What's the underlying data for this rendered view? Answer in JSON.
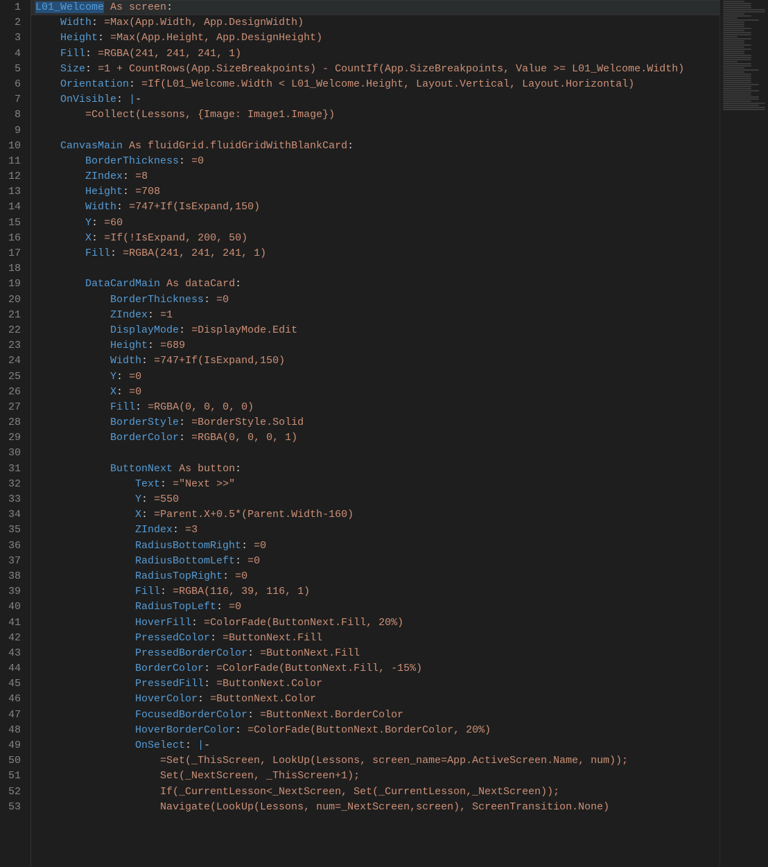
{
  "editor": {
    "active_line": 1,
    "lines": [
      {
        "n": 1,
        "html": "<span class='s-key sel'>L01_Welcome</span> <span class='s-type'>As screen</span><span class='s-punc'>:</span>"
      },
      {
        "n": 2,
        "html": "    <span class='s-key'>Width</span><span class='s-punc'>:</span> <span class='s-call'>=Max(App.Width, App.DesignWidth)</span>"
      },
      {
        "n": 3,
        "html": "    <span class='s-key'>Height</span><span class='s-punc'>:</span> <span class='s-call'>=Max(App.Height, App.DesignHeight)</span>"
      },
      {
        "n": 4,
        "html": "    <span class='s-key'>Fill</span><span class='s-punc'>:</span> <span class='s-call'>=RGBA(241, 241, 241, 1)</span>"
      },
      {
        "n": 5,
        "html": "    <span class='s-key'>Size</span><span class='s-punc'>:</span> <span class='s-call'>=1 + CountRows(App.SizeBreakpoints) - CountIf(App.SizeBreakpoints, Value &gt;= L01_Welcome.Width)</span>"
      },
      {
        "n": 6,
        "html": "    <span class='s-key'>Orientation</span><span class='s-punc'>:</span> <span class='s-call'>=If(L01_Welcome.Width &lt; L01_Welcome.Height, Layout.Vertical, Layout.Horizontal)</span>"
      },
      {
        "n": 7,
        "html": "    <span class='s-key'>OnVisible</span><span class='s-punc'>:</span> <span class='s-pipe'>|</span><span class='s-punc'>-</span>"
      },
      {
        "n": 8,
        "html": "        <span class='s-call'>=Collect(Lessons, {Image: Image1.Image})</span>"
      },
      {
        "n": 9,
        "html": ""
      },
      {
        "n": 10,
        "html": "    <span class='s-key'>CanvasMain</span> <span class='s-type'>As fluidGrid.fluidGridWithBlankCard</span><span class='s-punc'>:</span>"
      },
      {
        "n": 11,
        "html": "        <span class='s-key'>BorderThickness</span><span class='s-punc'>:</span> <span class='s-call'>=0</span>"
      },
      {
        "n": 12,
        "html": "        <span class='s-key'>ZIndex</span><span class='s-punc'>:</span> <span class='s-call'>=8</span>"
      },
      {
        "n": 13,
        "html": "        <span class='s-key'>Height</span><span class='s-punc'>:</span> <span class='s-call'>=708</span>"
      },
      {
        "n": 14,
        "html": "        <span class='s-key'>Width</span><span class='s-punc'>:</span> <span class='s-call'>=747+If(IsExpand,150)</span>"
      },
      {
        "n": 15,
        "html": "        <span class='s-key'>Y</span><span class='s-punc'>:</span> <span class='s-call'>=60</span>"
      },
      {
        "n": 16,
        "html": "        <span class='s-key'>X</span><span class='s-punc'>:</span> <span class='s-call'>=If(!IsExpand, 200, 50)</span>"
      },
      {
        "n": 17,
        "html": "        <span class='s-key'>Fill</span><span class='s-punc'>:</span> <span class='s-call'>=RGBA(241, 241, 241, 1)</span>"
      },
      {
        "n": 18,
        "html": ""
      },
      {
        "n": 19,
        "html": "        <span class='s-key'>DataCardMain</span> <span class='s-type'>As dataCard</span><span class='s-punc'>:</span>"
      },
      {
        "n": 20,
        "html": "            <span class='s-key'>BorderThickness</span><span class='s-punc'>:</span> <span class='s-call'>=0</span>"
      },
      {
        "n": 21,
        "html": "            <span class='s-key'>ZIndex</span><span class='s-punc'>:</span> <span class='s-call'>=1</span>"
      },
      {
        "n": 22,
        "html": "            <span class='s-key'>DisplayMode</span><span class='s-punc'>:</span> <span class='s-call'>=DisplayMode.Edit</span>"
      },
      {
        "n": 23,
        "html": "            <span class='s-key'>Height</span><span class='s-punc'>:</span> <span class='s-call'>=689</span>"
      },
      {
        "n": 24,
        "html": "            <span class='s-key'>Width</span><span class='s-punc'>:</span> <span class='s-call'>=747+If(IsExpand,150)</span>"
      },
      {
        "n": 25,
        "html": "            <span class='s-key'>Y</span><span class='s-punc'>:</span> <span class='s-call'>=0</span>"
      },
      {
        "n": 26,
        "html": "            <span class='s-key'>X</span><span class='s-punc'>:</span> <span class='s-call'>=0</span>"
      },
      {
        "n": 27,
        "html": "            <span class='s-key'>Fill</span><span class='s-punc'>:</span> <span class='s-call'>=RGBA(0, 0, 0, 0)</span>"
      },
      {
        "n": 28,
        "html": "            <span class='s-key'>BorderStyle</span><span class='s-punc'>:</span> <span class='s-call'>=BorderStyle.Solid</span>"
      },
      {
        "n": 29,
        "html": "            <span class='s-key'>BorderColor</span><span class='s-punc'>:</span> <span class='s-call'>=RGBA(0, 0, 0, 1)</span>"
      },
      {
        "n": 30,
        "html": ""
      },
      {
        "n": 31,
        "html": "            <span class='s-key'>ButtonNext</span> <span class='s-type'>As button</span><span class='s-punc'>:</span>"
      },
      {
        "n": 32,
        "html": "                <span class='s-key'>Text</span><span class='s-punc'>:</span> <span class='s-call'>=\"Next &gt;&gt;\"</span>"
      },
      {
        "n": 33,
        "html": "                <span class='s-key'>Y</span><span class='s-punc'>:</span> <span class='s-call'>=550</span>"
      },
      {
        "n": 34,
        "html": "                <span class='s-key'>X</span><span class='s-punc'>:</span> <span class='s-call'>=Parent.X+0.5*(Parent.Width-160)</span>"
      },
      {
        "n": 35,
        "html": "                <span class='s-key'>ZIndex</span><span class='s-punc'>:</span> <span class='s-call'>=3</span>"
      },
      {
        "n": 36,
        "html": "                <span class='s-key'>RadiusBottomRight</span><span class='s-punc'>:</span> <span class='s-call'>=0</span>"
      },
      {
        "n": 37,
        "html": "                <span class='s-key'>RadiusBottomLeft</span><span class='s-punc'>:</span> <span class='s-call'>=0</span>"
      },
      {
        "n": 38,
        "html": "                <span class='s-key'>RadiusTopRight</span><span class='s-punc'>:</span> <span class='s-call'>=0</span>"
      },
      {
        "n": 39,
        "html": "                <span class='s-key'>Fill</span><span class='s-punc'>:</span> <span class='s-call'>=RGBA(116, 39, 116, 1)</span>"
      },
      {
        "n": 40,
        "html": "                <span class='s-key'>RadiusTopLeft</span><span class='s-punc'>:</span> <span class='s-call'>=0</span>"
      },
      {
        "n": 41,
        "html": "                <span class='s-key'>HoverFill</span><span class='s-punc'>:</span> <span class='s-call'>=ColorFade(ButtonNext.Fill, 20%)</span>"
      },
      {
        "n": 42,
        "html": "                <span class='s-key'>PressedColor</span><span class='s-punc'>:</span> <span class='s-call'>=ButtonNext.Fill</span>"
      },
      {
        "n": 43,
        "html": "                <span class='s-key'>PressedBorderColor</span><span class='s-punc'>:</span> <span class='s-call'>=ButtonNext.Fill</span>"
      },
      {
        "n": 44,
        "html": "                <span class='s-key'>BorderColor</span><span class='s-punc'>:</span> <span class='s-call'>=ColorFade(ButtonNext.Fill, -15%)</span>"
      },
      {
        "n": 45,
        "html": "                <span class='s-key'>PressedFill</span><span class='s-punc'>:</span> <span class='s-call'>=ButtonNext.Color</span>"
      },
      {
        "n": 46,
        "html": "                <span class='s-key'>HoverColor</span><span class='s-punc'>:</span> <span class='s-call'>=ButtonNext.Color</span>"
      },
      {
        "n": 47,
        "html": "                <span class='s-key'>FocusedBorderColor</span><span class='s-punc'>:</span> <span class='s-call'>=ButtonNext.BorderColor</span>"
      },
      {
        "n": 48,
        "html": "                <span class='s-key'>HoverBorderColor</span><span class='s-punc'>:</span> <span class='s-call'>=ColorFade(ButtonNext.BorderColor, 20%)</span>"
      },
      {
        "n": 49,
        "html": "                <span class='s-key'>OnSelect</span><span class='s-punc'>:</span> <span class='s-pipe'>|</span><span class='s-punc'>-</span>"
      },
      {
        "n": 50,
        "html": "                    <span class='s-call'>=Set(_ThisScreen, LookUp(Lessons, screen_name=App.ActiveScreen.Name, num));</span>"
      },
      {
        "n": 51,
        "html": "                    <span class='s-call'>Set(_NextScreen, _ThisScreen+1);</span>"
      },
      {
        "n": 52,
        "html": "                    <span class='s-call'>If(_CurrentLesson&lt;_NextScreen, Set(_CurrentLesson,_NextScreen));</span>"
      },
      {
        "n": 53,
        "html": "                    <span class='s-call'>Navigate(LookUp(Lessons, num=_NextScreen,screen), ScreenTransition.None)</span>"
      }
    ],
    "minimap_pattern": [
      "w2",
      "w3",
      "w3",
      "w3",
      "w5",
      "w5",
      "w2",
      "w3",
      "w1",
      "w4",
      "w2",
      "w2",
      "w2",
      "w3",
      "w2",
      "w3",
      "w3",
      "w1",
      "w3",
      "w2",
      "w2",
      "w3",
      "w2",
      "w3",
      "w2",
      "w2",
      "w3",
      "w3",
      "w3",
      "w1",
      "w3",
      "w3",
      "w2",
      "w4",
      "w2",
      "w3",
      "w3",
      "w3",
      "w3",
      "w3",
      "w4",
      "w3",
      "w3",
      "w4",
      "w3",
      "w3",
      "w4",
      "w4",
      "w3",
      "w5",
      "w4",
      "w5",
      "w5"
    ]
  }
}
